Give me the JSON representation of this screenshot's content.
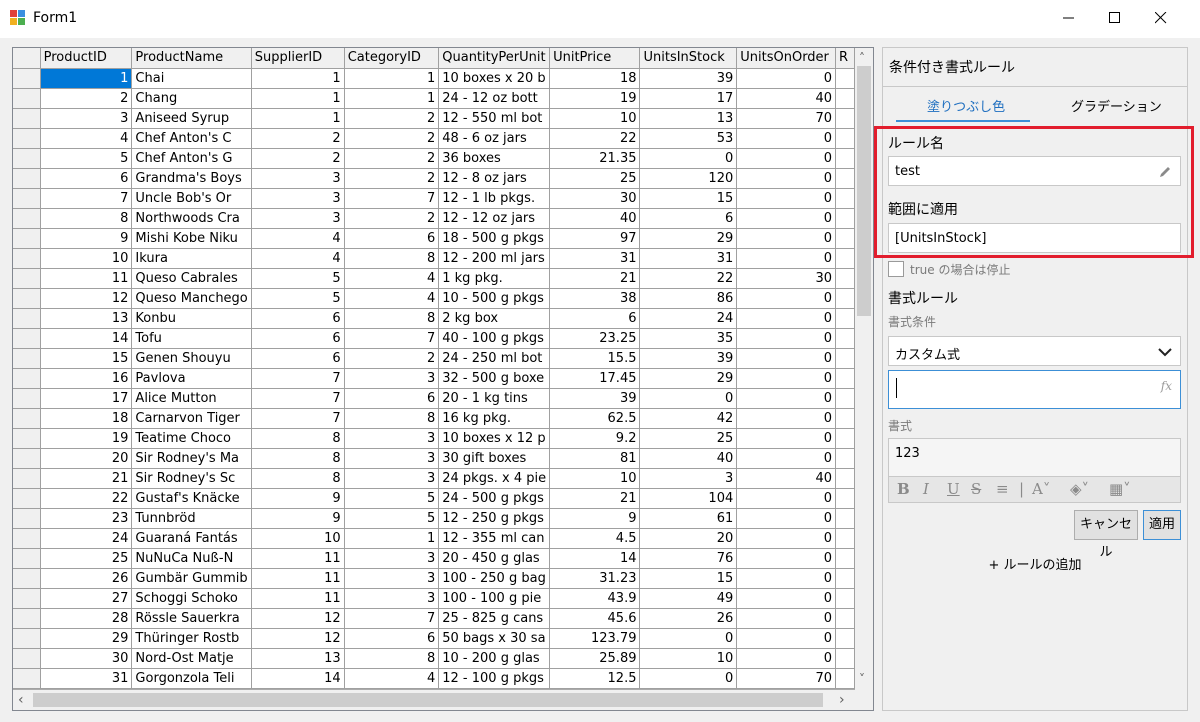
{
  "window": {
    "title": "Form1"
  },
  "grid": {
    "columns": [
      "ProductID",
      "ProductName",
      "SupplierID",
      "CategoryID",
      "QuantityPerUnit",
      "UnitPrice",
      "UnitsInStock",
      "UnitsOnOrder",
      "R"
    ],
    "rows": [
      [
        "1",
        "Chai",
        "1",
        "1",
        "10 boxes x 20 b",
        "18",
        "39",
        "0"
      ],
      [
        "2",
        "Chang",
        "1",
        "1",
        "24 - 12 oz bott",
        "19",
        "17",
        "40"
      ],
      [
        "3",
        "Aniseed Syrup",
        "1",
        "2",
        "12 - 550 ml bot",
        "10",
        "13",
        "70"
      ],
      [
        "4",
        "Chef Anton's C",
        "2",
        "2",
        "48 - 6 oz jars",
        "22",
        "53",
        "0"
      ],
      [
        "5",
        "Chef Anton's G",
        "2",
        "2",
        "36 boxes",
        "21.35",
        "0",
        "0"
      ],
      [
        "6",
        "Grandma's Boys",
        "3",
        "2",
        "12 - 8 oz jars",
        "25",
        "120",
        "0"
      ],
      [
        "7",
        "Uncle Bob's Or",
        "3",
        "7",
        "12 - 1 lb pkgs.",
        "30",
        "15",
        "0"
      ],
      [
        "8",
        "Northwoods Cra",
        "3",
        "2",
        "12 - 12 oz jars",
        "40",
        "6",
        "0"
      ],
      [
        "9",
        "Mishi Kobe Niku",
        "4",
        "6",
        "18 - 500 g pkgs",
        "97",
        "29",
        "0"
      ],
      [
        "10",
        "Ikura",
        "4",
        "8",
        "12 - 200 ml jars",
        "31",
        "31",
        "0"
      ],
      [
        "11",
        "Queso Cabrales",
        "5",
        "4",
        "1 kg pkg.",
        "21",
        "22",
        "30"
      ],
      [
        "12",
        "Queso Manchego",
        "5",
        "4",
        "10 - 500 g pkgs",
        "38",
        "86",
        "0"
      ],
      [
        "13",
        "Konbu",
        "6",
        "8",
        "2 kg box",
        "6",
        "24",
        "0"
      ],
      [
        "14",
        "Tofu",
        "6",
        "7",
        "40 - 100 g pkgs",
        "23.25",
        "35",
        "0"
      ],
      [
        "15",
        "Genen Shouyu",
        "6",
        "2",
        "24 - 250 ml bot",
        "15.5",
        "39",
        "0"
      ],
      [
        "16",
        "Pavlova",
        "7",
        "3",
        "32 - 500 g boxe",
        "17.45",
        "29",
        "0"
      ],
      [
        "17",
        "Alice Mutton",
        "7",
        "6",
        "20 - 1 kg tins",
        "39",
        "0",
        "0"
      ],
      [
        "18",
        "Carnarvon Tiger",
        "7",
        "8",
        "16 kg pkg.",
        "62.5",
        "42",
        "0"
      ],
      [
        "19",
        "Teatime Choco",
        "8",
        "3",
        "10 boxes x 12 p",
        "9.2",
        "25",
        "0"
      ],
      [
        "20",
        "Sir Rodney's Ma",
        "8",
        "3",
        "30 gift boxes",
        "81",
        "40",
        "0"
      ],
      [
        "21",
        "Sir Rodney's Sc",
        "8",
        "3",
        "24 pkgs. x 4 pie",
        "10",
        "3",
        "40"
      ],
      [
        "22",
        "Gustaf's Knäcke",
        "9",
        "5",
        "24 - 500 g pkgs",
        "21",
        "104",
        "0"
      ],
      [
        "23",
        "Tunnbröd",
        "9",
        "5",
        "12 - 250 g pkgs",
        "9",
        "61",
        "0"
      ],
      [
        "24",
        "Guaraná Fantás",
        "10",
        "1",
        "12 - 355 ml can",
        "4.5",
        "20",
        "0"
      ],
      [
        "25",
        "NuNuCa Nuß-N",
        "11",
        "3",
        "20 - 450 g glas",
        "14",
        "76",
        "0"
      ],
      [
        "26",
        "Gumbär Gummib",
        "11",
        "3",
        "100 - 250 g bag",
        "31.23",
        "15",
        "0"
      ],
      [
        "27",
        "Schoggi Schoko",
        "11",
        "3",
        "100 - 100 g pie",
        "43.9",
        "49",
        "0"
      ],
      [
        "28",
        "Rössle Sauerkra",
        "12",
        "7",
        "25 - 825 g cans",
        "45.6",
        "26",
        "0"
      ],
      [
        "29",
        "Thüringer Rostb",
        "12",
        "6",
        "50 bags x 30 sa",
        "123.79",
        "0",
        "0"
      ],
      [
        "30",
        "Nord-Ost Matje",
        "13",
        "8",
        "10 - 200 g glas",
        "25.89",
        "10",
        "0"
      ],
      [
        "31",
        "Gorgonzola Teli",
        "14",
        "4",
        "12 - 100 g pkgs",
        "12.5",
        "0",
        "70"
      ]
    ]
  },
  "panel": {
    "title": "条件付き書式ルール",
    "tab_fill": "塗りつぶし色",
    "tab_gradient": "グラデーション",
    "rule_name_label": "ルール名",
    "rule_name_value": "test",
    "apply_range_label": "範囲に適用",
    "apply_range_value": "[UnitsInStock]",
    "stop_if_true": "true の場合は停止",
    "format_rule_label": "書式ルール",
    "format_condition_label": "書式条件",
    "format_condition_value": "カスタム式",
    "formula_icon": "fx",
    "format_label": "書式",
    "format_preview": "123",
    "cancel_label": "キャンセル",
    "apply_label": "適用",
    "add_rule_label": "+ ルールの追加"
  },
  "colors": {
    "selection": "#0078d7",
    "highlight_frame": "#e21d2d",
    "tab_active": "#3c8fd6"
  }
}
